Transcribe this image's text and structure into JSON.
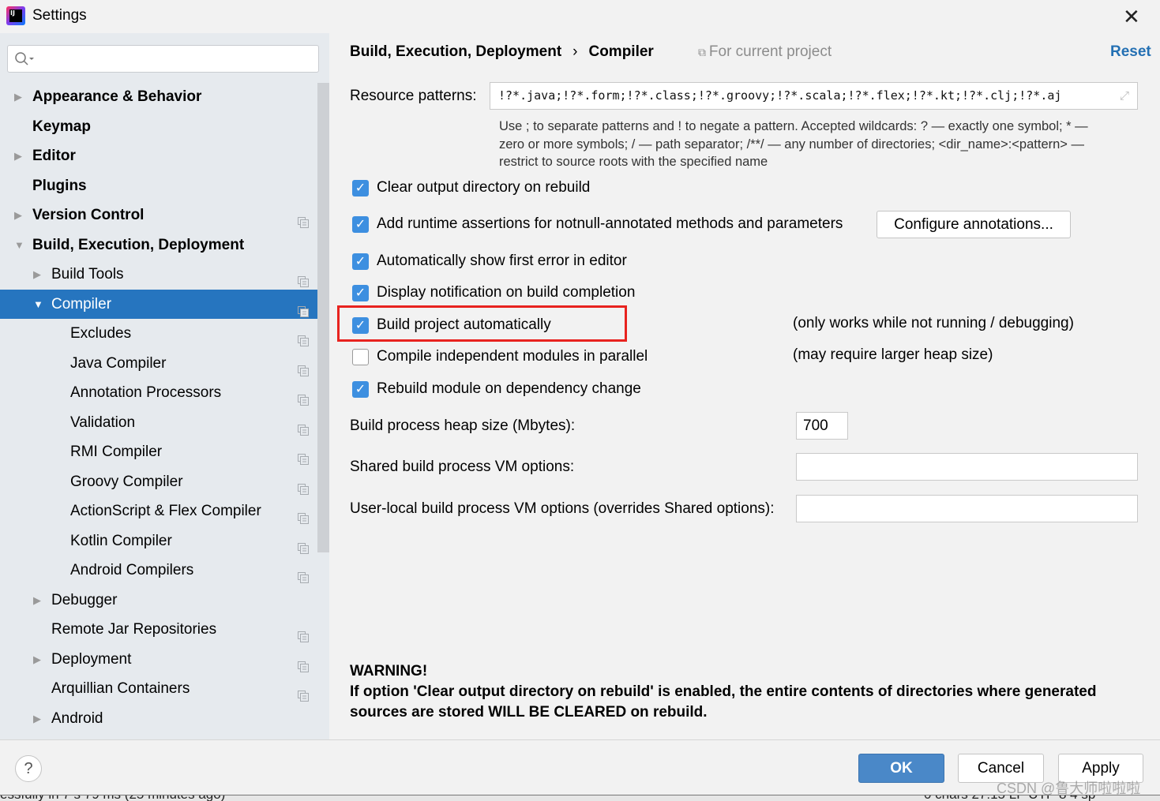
{
  "window": {
    "title": "Settings",
    "app_icon_text": "IJ"
  },
  "sidebar": {
    "search_placeholder": "",
    "items": [
      {
        "label": "Appearance & Behavior",
        "level": 0,
        "expandable": true,
        "expanded": false,
        "bold": true,
        "project_icon": false
      },
      {
        "label": "Keymap",
        "level": 0,
        "expandable": false,
        "bold": true,
        "project_icon": false
      },
      {
        "label": "Editor",
        "level": 0,
        "expandable": true,
        "expanded": false,
        "bold": true,
        "project_icon": false
      },
      {
        "label": "Plugins",
        "level": 0,
        "expandable": false,
        "bold": true,
        "project_icon": false
      },
      {
        "label": "Version Control",
        "level": 0,
        "expandable": true,
        "expanded": false,
        "bold": true,
        "project_icon": true
      },
      {
        "label": "Build, Execution, Deployment",
        "level": 0,
        "expandable": true,
        "expanded": true,
        "bold": true,
        "project_icon": false
      },
      {
        "label": "Build Tools",
        "level": 1,
        "expandable": true,
        "expanded": false,
        "project_icon": true
      },
      {
        "label": "Compiler",
        "level": 1,
        "expandable": true,
        "expanded": true,
        "selected": true,
        "project_icon": true
      },
      {
        "label": "Excludes",
        "level": 2,
        "project_icon": true
      },
      {
        "label": "Java Compiler",
        "level": 2,
        "project_icon": true
      },
      {
        "label": "Annotation Processors",
        "level": 2,
        "project_icon": true
      },
      {
        "label": "Validation",
        "level": 2,
        "project_icon": true
      },
      {
        "label": "RMI Compiler",
        "level": 2,
        "project_icon": true
      },
      {
        "label": "Groovy Compiler",
        "level": 2,
        "project_icon": true
      },
      {
        "label": "ActionScript & Flex Compiler",
        "level": 2,
        "project_icon": true
      },
      {
        "label": "Kotlin Compiler",
        "level": 2,
        "project_icon": true
      },
      {
        "label": "Android Compilers",
        "level": 2,
        "project_icon": true
      },
      {
        "label": "Debugger",
        "level": 1,
        "expandable": true,
        "expanded": false,
        "project_icon": false
      },
      {
        "label": "Remote Jar Repositories",
        "level": 1,
        "project_icon": true
      },
      {
        "label": "Deployment",
        "level": 1,
        "expandable": true,
        "expanded": false,
        "project_icon": true
      },
      {
        "label": "Arquillian Containers",
        "level": 1,
        "project_icon": true
      },
      {
        "label": "Android",
        "level": 1,
        "expandable": true,
        "expanded": false,
        "project_icon": false
      }
    ]
  },
  "header": {
    "breadcrumb": [
      "Build, Execution, Deployment",
      "Compiler"
    ],
    "separator": "›",
    "scope": "For current project",
    "reset": "Reset"
  },
  "main": {
    "resource_label": "Resource patterns:",
    "resource_value": "!?*.java;!?*.form;!?*.class;!?*.groovy;!?*.scala;!?*.flex;!?*.kt;!?*.clj;!?*.aj",
    "help": [
      "Use ; to separate patterns and ! to negate a pattern. Accepted wildcards: ? — exactly one symbol; * —",
      "zero or more symbols; / — path separator; /**/ — any number of directories; <dir_name>:<pattern> —",
      "restrict to source roots with the specified name"
    ],
    "options": [
      {
        "label": "Clear output directory on rebuild",
        "checked": true
      },
      {
        "label": "Add runtime assertions for notnull-annotated methods and parameters",
        "checked": true
      },
      {
        "label": "Automatically show first error in editor",
        "checked": true
      },
      {
        "label": "Display notification on build completion",
        "checked": true
      },
      {
        "label": "Build project automatically",
        "checked": true,
        "note": "(only works while not running / debugging)"
      },
      {
        "label": "Compile independent modules in parallel",
        "checked": false,
        "note": "(may require larger heap size)"
      },
      {
        "label": "Rebuild module on dependency change",
        "checked": true
      }
    ],
    "configure_button": "Configure annotations...",
    "heap_label": "Build process heap size (Mbytes):",
    "heap_value": "700",
    "shared_label": "Shared build process VM options:",
    "shared_value": "",
    "user_label": "User-local build process VM options (overrides Shared options):",
    "user_value": "",
    "warning_title": "WARNING!",
    "warning_lines": [
      "If option 'Clear output directory on rebuild' is enabled, the entire contents of directories where generated",
      "sources are stored WILL BE CLEARED on rebuild."
    ]
  },
  "footer": {
    "help": "?",
    "ok": "OK",
    "cancel": "Cancel",
    "apply": "Apply"
  },
  "background_status": {
    "left": "essfully in 7 s 79 ms (25 minutes ago)",
    "right": "0 chars   27:15   LF   UTF-8   4 sp"
  },
  "watermark": "CSDN @鲁大师啦啦啦",
  "colors": {
    "selection": "#2675bf",
    "checkbox": "#3d8fe0",
    "ok_button": "#4a88c8",
    "highlight_box": "#e8231f",
    "link": "#2470b3"
  }
}
